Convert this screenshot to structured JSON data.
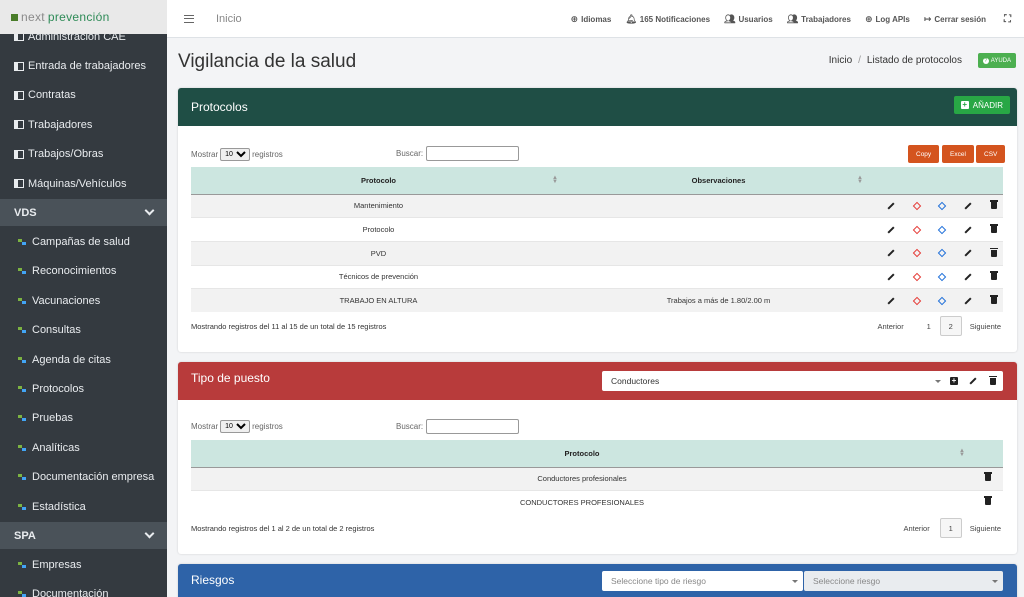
{
  "brand": {
    "part1": "next",
    "part2": "prevención"
  },
  "sidebar": {
    "items": [
      {
        "label": "Administración CAE"
      },
      {
        "label": "Entrada de trabajadores"
      },
      {
        "label": "Contratas"
      },
      {
        "label": "Trabajadores"
      },
      {
        "label": "Trabajos/Obras"
      },
      {
        "label": "Máquinas/Vehículos"
      }
    ],
    "group_vds": "VDS",
    "vds_items": [
      {
        "label": "Campañas de salud"
      },
      {
        "label": "Reconocimientos"
      },
      {
        "label": "Vacunaciones"
      },
      {
        "label": "Consultas"
      },
      {
        "label": "Agenda de citas"
      },
      {
        "label": "Protocolos"
      },
      {
        "label": "Pruebas"
      },
      {
        "label": "Analíticas"
      },
      {
        "label": "Documentación empresa"
      },
      {
        "label": "Estadística"
      }
    ],
    "group_spa": "SPA",
    "spa_items": [
      {
        "label": "Empresas"
      },
      {
        "label": "Documentación"
      }
    ]
  },
  "topbar": {
    "home": "Inicio",
    "links": {
      "idiomas": "Idiomas",
      "notificaciones": "165 Notificaciones",
      "usuarios": "Usuarios",
      "trabajadores": "Trabajadores",
      "logapis": "Log APIs",
      "logout": "Cerrar sesión"
    }
  },
  "header": {
    "title": "Vigilancia de la salud",
    "crumb_home": "Inicio",
    "crumb_sep": "/",
    "crumb_current": "Listado de protocolos",
    "help": "AYUDA"
  },
  "protocolos": {
    "title": "Protocolos",
    "add": "AÑADIR",
    "show_label": "Mostrar",
    "show_value": "10",
    "show_suffix": "registros",
    "search_label": "Buscar:",
    "export": {
      "copy": "Copy",
      "excel": "Excel",
      "csv": "CSV"
    },
    "columns": {
      "protocolo": "Protocolo",
      "observaciones": "Observaciones"
    },
    "rows": [
      {
        "protocolo": "Mantenimiento",
        "observaciones": ""
      },
      {
        "protocolo": "Protocolo",
        "observaciones": ""
      },
      {
        "protocolo": "PVD",
        "observaciones": ""
      },
      {
        "protocolo": "Técnicos de prevención",
        "observaciones": ""
      },
      {
        "protocolo": "TRABAJO EN ALTURA",
        "observaciones": "Trabajos a más de 1.80/2.00 m"
      }
    ],
    "info": "Mostrando registros del 11 al 15 de un total de 15 registros",
    "pager": {
      "prev": "Anterior",
      "p1": "1",
      "p2": "2",
      "next": "Siguiente"
    }
  },
  "puesto": {
    "title": "Tipo de puesto",
    "selected": "Conductores",
    "show_label": "Mostrar",
    "show_value": "10",
    "show_suffix": "registros",
    "search_label": "Buscar:",
    "column": "Protocolo",
    "rows": [
      {
        "protocolo": "Conductores profesionales"
      },
      {
        "protocolo": "CONDUCTORES PROFESIONALES"
      }
    ],
    "info": "Mostrando registros del 1 al 2 de un total de 2 registros",
    "pager": {
      "prev": "Anterior",
      "p1": "1",
      "next": "Siguiente"
    }
  },
  "riesgos": {
    "title": "Riesgos",
    "tipo_placeholder": "Seleccione tipo de riesgo",
    "riesgo_placeholder": "Seleccione riesgo"
  },
  "colors": {
    "protocolos": "#1f4e45",
    "puesto": "#b83b3b",
    "riesgos": "#2e63a8",
    "sidebar": "#343a40"
  }
}
